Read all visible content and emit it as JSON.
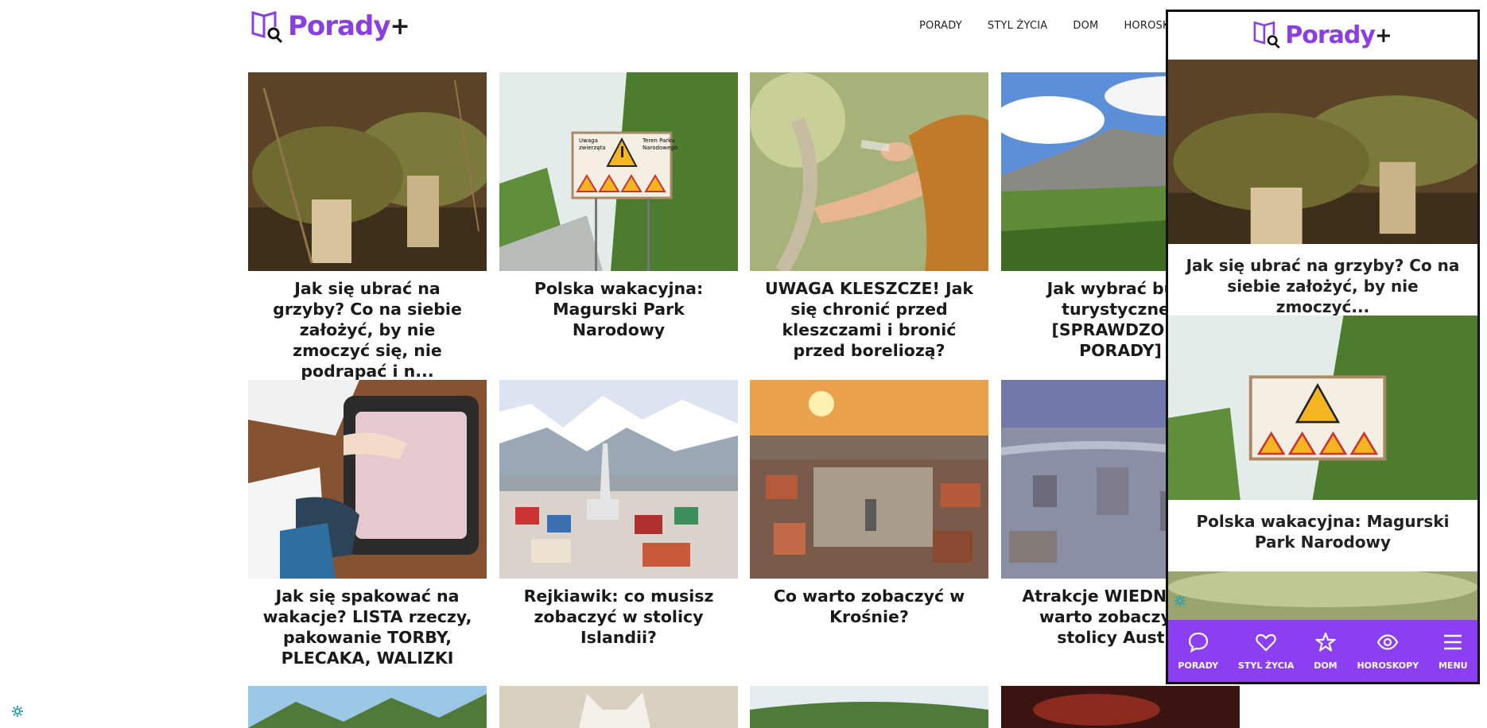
{
  "brand": {
    "name": "Porady",
    "plus": "+"
  },
  "nav": [
    "PORADY",
    "STYL ŻYCIA",
    "DOM",
    "HOROSKOPY"
  ],
  "articles": [
    {
      "title": "Jak się ubrać na grzyby? Co na siebie założyć, by nie zmoczyć się, nie podrapać i n..."
    },
    {
      "title": "Polska wakacyjna: Magurski Park Narodowy"
    },
    {
      "title": "UWAGA KLESZCZE! Jak się chronić przed kleszczami i bronić przed boreliozą?"
    },
    {
      "title": "Jak wybrać buty turystyczne? [SPRAWDZONE PORADY]"
    },
    {
      "title": "Jak się spakować na wakacje? LISTA rzeczy, pakowanie TORBY, PLECAKA, WALIZKI"
    },
    {
      "title": "Rejkiawik: co musisz zobaczyć w stolicy Islandii?"
    },
    {
      "title": "Co warto zobaczyć w Krośnie?"
    },
    {
      "title": "Atrakcje WIEDNIA: co warto zobaczyć w stolicy Austrii"
    }
  ],
  "sign": {
    "line1": "Uwaga",
    "line2": "zwierzęta",
    "line3": "Teren Parku",
    "line4": "Narodowego"
  },
  "mobile": {
    "cards": [
      {
        "title": "Jak się ubrać na grzyby? Co na siebie założyć, by nie zmoczyć..."
      },
      {
        "title": "Polska wakacyjna: Magurski Park Narodowy"
      }
    ],
    "bottom_nav": [
      {
        "label": "PORADY",
        "icon": "chat-bubble-icon"
      },
      {
        "label": "STYL ŻYCIA",
        "icon": "heart-icon"
      },
      {
        "label": "DOM",
        "icon": "star-icon"
      },
      {
        "label": "HOROSKOPY",
        "icon": "eye-icon"
      },
      {
        "label": "MENU",
        "icon": "hamburger-menu-icon"
      }
    ]
  },
  "colors": {
    "brand": "#8a3fe0",
    "bottom_nav_bg": "#8c3ff0",
    "gear": "#2aa0b0"
  }
}
